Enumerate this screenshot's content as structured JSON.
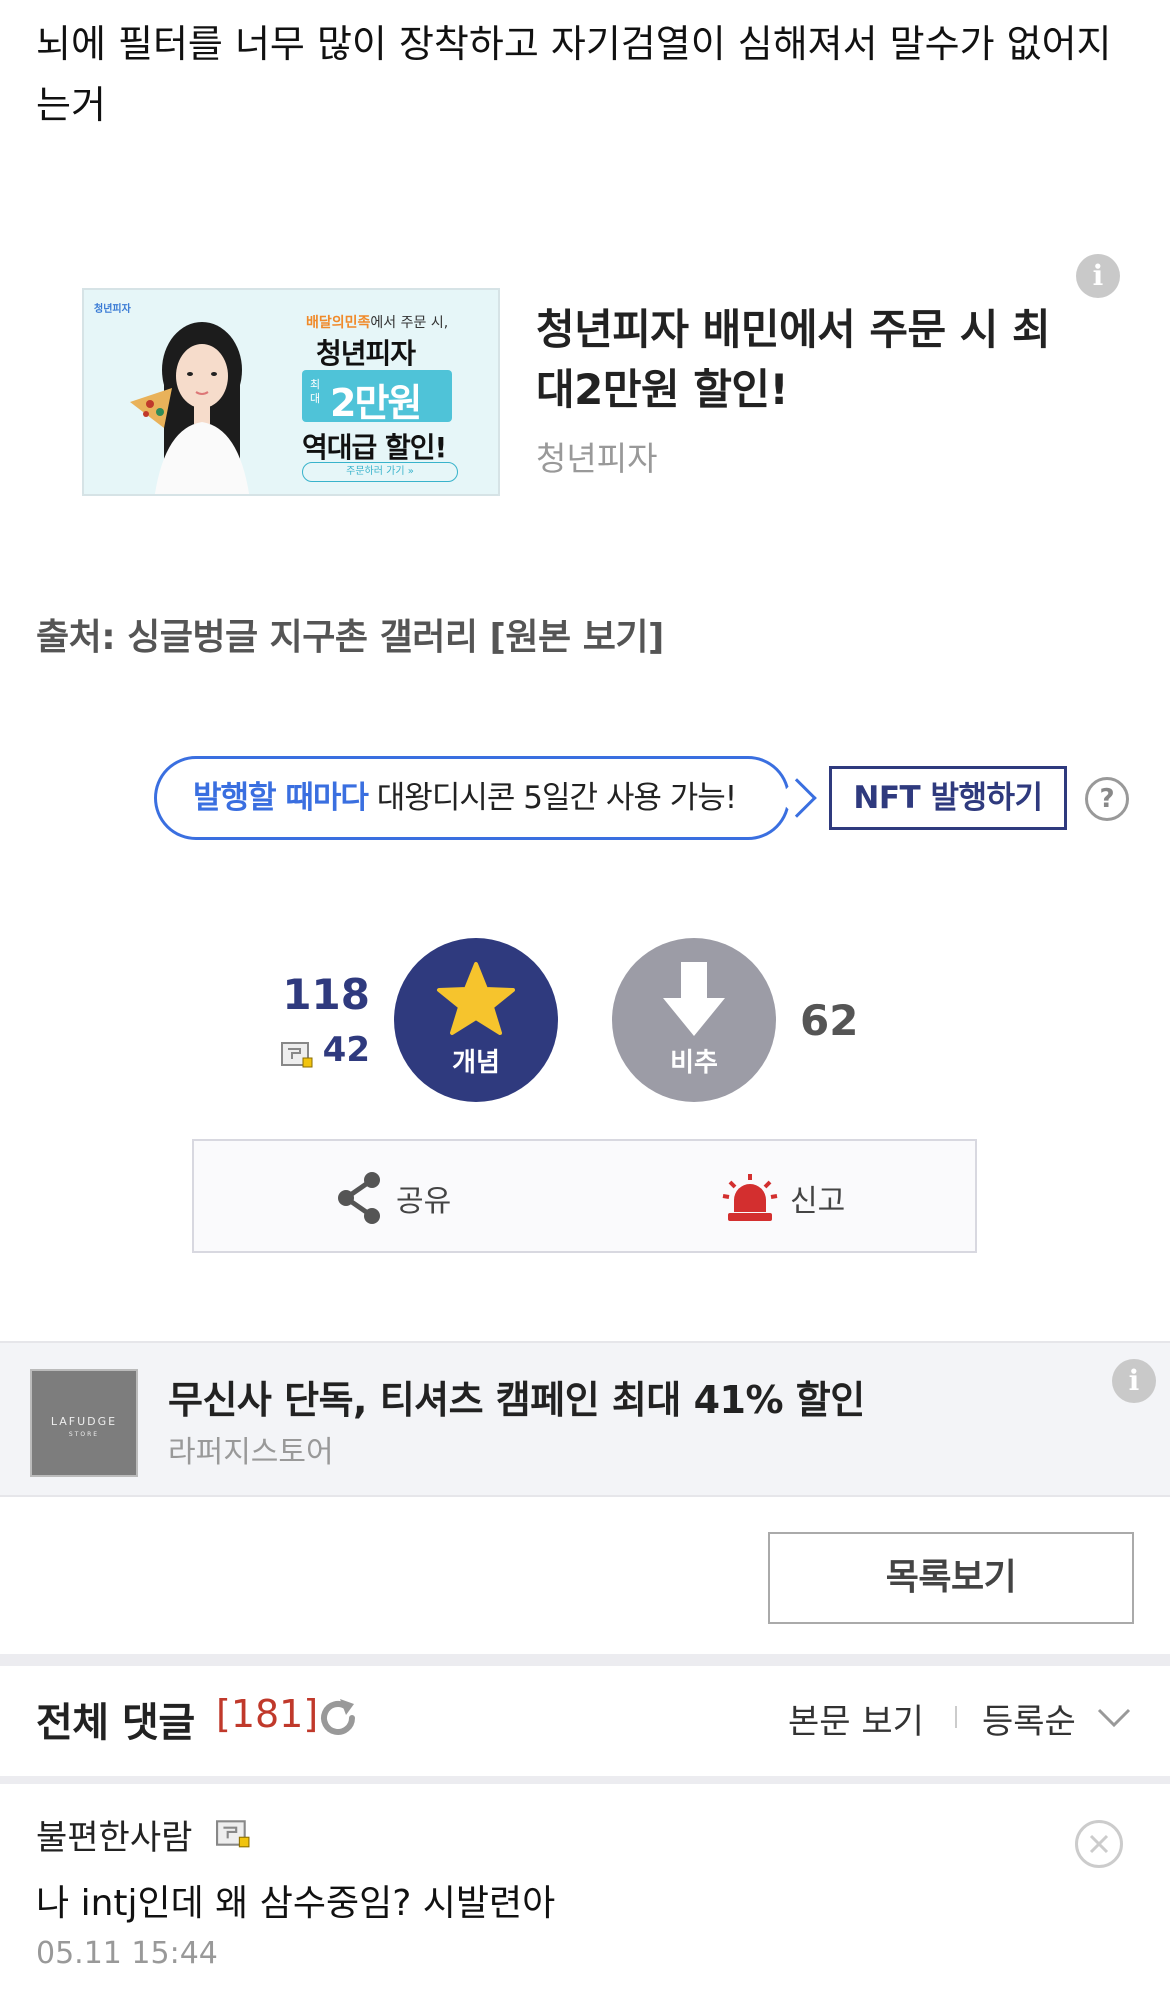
{
  "post": {
    "text": "뇌에 필터를 너무 많이 장착하고 자기검열이 심해져서 말수가 없어지는거"
  },
  "ad_top": {
    "thumb_brand": "청년피자",
    "thumb_line1_accent": "배달의민족",
    "thumb_line1_rest": "에서 주문 시,",
    "thumb_line2": "청년피자",
    "thumb_small": "최대",
    "thumb_big": "2만원",
    "thumb_line4": "역대급 할인!",
    "thumb_cta": "주문하러 가기 »",
    "title": "청년피자 배민에서 주문 시 최대2만원 할인!",
    "advertiser": "청년피자",
    "info_icon": "info-icon"
  },
  "source": {
    "text": "출처: 싱글벙글 지구촌 갤러리 [원본 보기]"
  },
  "nft": {
    "bubble_highlight": "발행할 때마다",
    "bubble_rest": " 대왕디시콘 5일간 사용 가능!",
    "button": "NFT 발행하기",
    "help": "?"
  },
  "votes": {
    "up_count": "118",
    "gonick_count": "42",
    "up_label": "개념",
    "down_label": "비추",
    "down_count": "62",
    "up_color": "#2f3a7e",
    "down_color": "#9c9ca6"
  },
  "actions": {
    "share": "공유",
    "report": "신고"
  },
  "ad_bottom": {
    "thumb_l1": "LAFUDGE",
    "thumb_l2": "STORE",
    "title": "무신사 단독, 티셔츠 캠페인 최대 41% 할인",
    "advertiser": "라퍼지스토어"
  },
  "list_button": "목록보기",
  "comments": {
    "header": "전체 댓글",
    "count": "[181]",
    "view_body": "본문 보기",
    "sort": "등록순",
    "items": [
      {
        "author": "불편한사람",
        "body": "나 intj인데 왜 삼수중임? 시발련아",
        "date": "05.11 15:44"
      }
    ]
  }
}
